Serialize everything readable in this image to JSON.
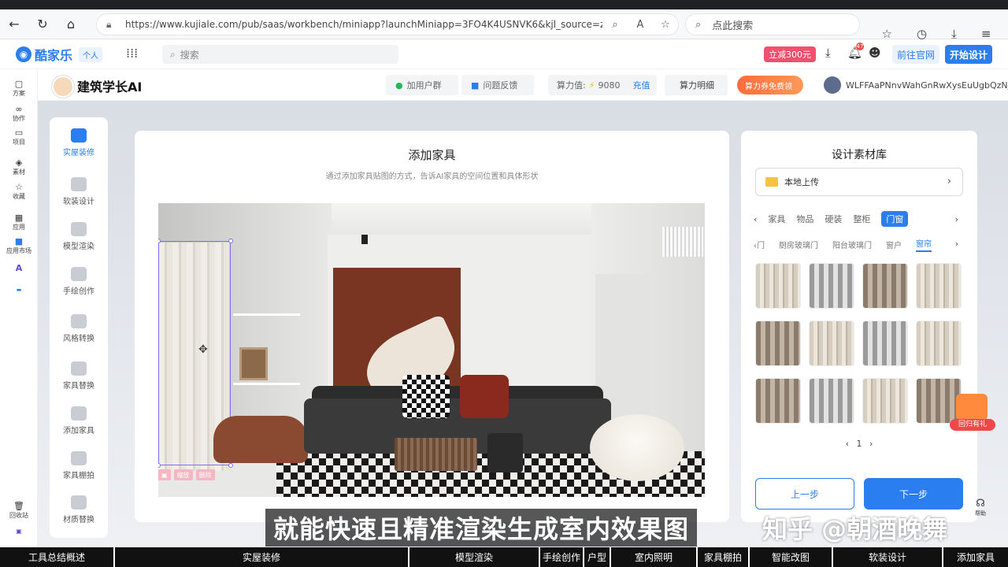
{
  "browser": {
    "url": "https://www.kujiale.com/pub/saas/workbench/miniapp?launchMiniapp=3FO4K4USNVK6&kjl_source=zhuzhan_n...",
    "search_placeholder": "点此搜索"
  },
  "app": {
    "brand": "酷家乐",
    "mode": "个人",
    "search_placeholder": "搜索",
    "promo": "立减300元",
    "notification_count": "47",
    "site_button": "前往官网",
    "start_button": "开始设计"
  },
  "rail": [
    {
      "label": "方案",
      "icon": "document-icon"
    },
    {
      "label": "协作",
      "icon": "collab-icon"
    },
    {
      "label": "项目",
      "icon": "folder-icon"
    },
    {
      "label": "素材",
      "icon": "cube-icon"
    },
    {
      "label": "收藏",
      "icon": "star-icon"
    },
    {
      "label": "应用",
      "icon": "apps-icon"
    },
    {
      "label": "应用市场",
      "icon": "market-icon"
    },
    {
      "label": "回收站",
      "icon": "trash-icon"
    }
  ],
  "tool": {
    "title": "建筑学长AI",
    "group_link": "加用户群",
    "feedback": "问题反馈",
    "credits_label": "算力值:",
    "credits_value": "9080",
    "recharge": "充值",
    "credits_detail": "算力明细",
    "coupon": "算力券免费领",
    "user_id": "WLFFAaPNnvWahGnRwXysEuUgbQzNjV"
  },
  "side_menu": [
    {
      "label": "实屋装修",
      "active": true
    },
    {
      "label": "软装设计",
      "active": false
    },
    {
      "label": "模型渲染",
      "active": false
    },
    {
      "label": "手绘创作",
      "active": false
    },
    {
      "label": "风格转换",
      "active": false
    },
    {
      "label": "家具替换",
      "active": false
    },
    {
      "label": "添加家具",
      "active": false
    },
    {
      "label": "家具棚拍",
      "active": false
    },
    {
      "label": "材质替换",
      "active": false
    }
  ],
  "canvas": {
    "title": "添加家具",
    "subtitle": "通过添加家具贴图的方式，告诉AI家具的空间位置和具体形状",
    "mini_tools": [
      "",
      "缩放",
      "删除"
    ]
  },
  "library": {
    "title": "设计素材库",
    "upload_label": "本地上传",
    "categories": [
      "家具",
      "物品",
      "硬装",
      "整柜",
      "门窗"
    ],
    "active_category": "门窗",
    "subcategories": [
      "门",
      "厨房玻璃门",
      "阳台玻璃门",
      "窗户",
      "窗帘"
    ],
    "active_subcategory": "窗帘",
    "page": "1",
    "prev_button": "上一步",
    "next_button": "下一步"
  },
  "gift_label": "回归有礼",
  "help_label": "帮助",
  "subtitle_text": "就能快速且精准渲染生成室内效果图",
  "watermark": "知乎 @朝酒晚舞",
  "chapters": [
    "工具总结概述",
    "实屋装修",
    "模型渲染",
    "手绘创作",
    "户型",
    "室内照明",
    "家具棚拍",
    "智能改图",
    "软装设计",
    "添加家具"
  ]
}
